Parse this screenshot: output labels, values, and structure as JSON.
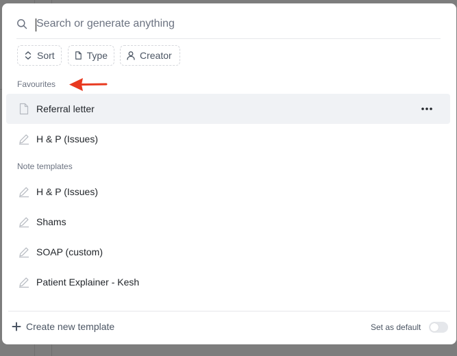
{
  "search": {
    "placeholder": "Search or generate anything",
    "value": ""
  },
  "filters": {
    "sort": {
      "label": "Sort",
      "icon": "sort-icon"
    },
    "type": {
      "label": "Type",
      "icon": "file-icon"
    },
    "creator": {
      "label": "Creator",
      "icon": "user-icon"
    }
  },
  "sections": {
    "favourites": {
      "label": "Favourites",
      "items": [
        {
          "label": "Referral letter",
          "icon": "document-icon",
          "active": true
        },
        {
          "label": "H & P (Issues)",
          "icon": "pencil-icon"
        }
      ]
    },
    "note_templates": {
      "label": "Note templates",
      "items": [
        {
          "label": "H & P (Issues)",
          "icon": "pencil-icon"
        },
        {
          "label": "Shams",
          "icon": "pencil-icon"
        },
        {
          "label": "SOAP (custom)",
          "icon": "pencil-icon"
        },
        {
          "label": "Patient Explainer - Kesh",
          "icon": "pencil-icon"
        }
      ]
    }
  },
  "footer": {
    "create_label": "Create new template",
    "default_label": "Set as default",
    "default_on": false
  },
  "colors": {
    "annotation_arrow": "#e8391f",
    "active_row": "#f0f2f5",
    "backdrop": "#7d7d7d"
  }
}
